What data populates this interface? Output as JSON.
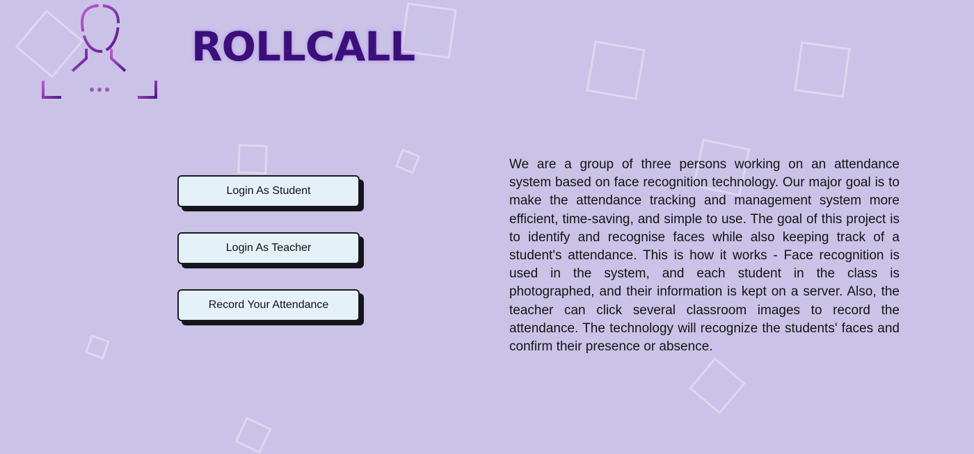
{
  "brand": {
    "title": "ROLLCALL",
    "logo_icon": "face-scan-icon",
    "colors": {
      "title": "#3c0f7a",
      "logo_gradient_start": "#b04fc7",
      "logo_gradient_end": "#5a1a8c"
    }
  },
  "menu": {
    "buttons": [
      {
        "label": "Login As Student"
      },
      {
        "label": "Login As Teacher"
      },
      {
        "label": "Record Your Attendance"
      }
    ]
  },
  "about": {
    "text": "We are a group of three persons working on an attendance system based on face recognition technology. Our major goal is to make the attendance tracking and management system more efficient, time-saving, and simple to use. The goal of this project is to identify and recognise faces while also keeping track of a student's attendance. This is how it works - Face recognition is used in the system, and each student in the class is photographed, and their information is kept on a server. Also, the teacher can click several classroom images to record the attendance. The technology will recognize the students' faces and confirm their presence or absence."
  },
  "theme": {
    "background": "#cac3e7",
    "button_bg": "#e5f1f9",
    "button_shadow": "#15141c"
  }
}
